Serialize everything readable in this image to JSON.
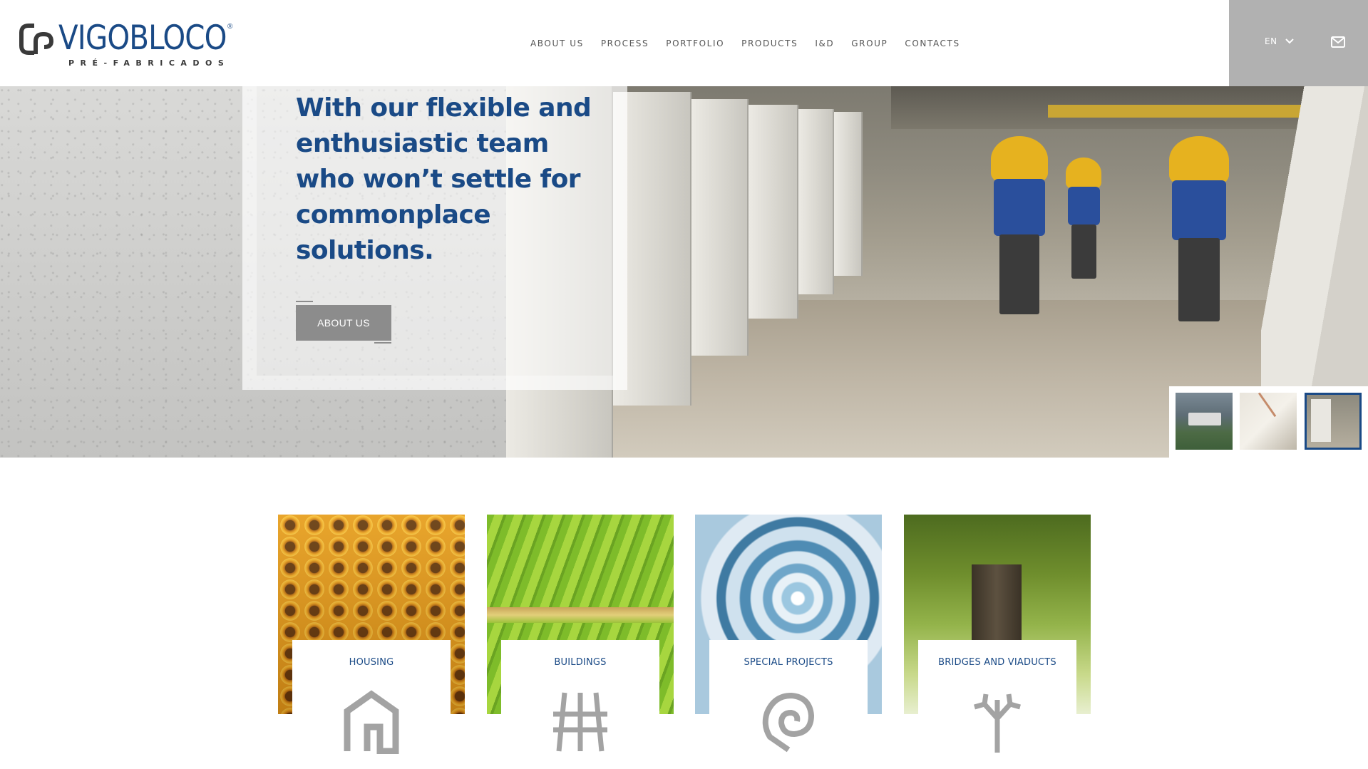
{
  "brand": {
    "name": "VIGOBLOCO",
    "registered": "®",
    "tagline": "PRÉ-FABRICADOS"
  },
  "nav": {
    "items": [
      {
        "label": "ABOUT US"
      },
      {
        "label": "PROCESS"
      },
      {
        "label": "PORTFOLIO"
      },
      {
        "label": "PRODUCTS"
      },
      {
        "label": "I&D"
      },
      {
        "label": "GROUP"
      },
      {
        "label": "CONTACTS"
      }
    ]
  },
  "utility": {
    "language": "EN",
    "language_icon": "chevron-down-icon",
    "contact_icon": "envelope-icon",
    "background": "#b1b1b1"
  },
  "hero": {
    "title": "With our flexible and enthusiastic team who won’t settle for commonplace solutions.",
    "button_label": "ABOUT US",
    "active_slide": 3,
    "slide_count": 3
  },
  "categories": [
    {
      "label": "HOUSING",
      "icon": "house-icon"
    },
    {
      "label": "BUILDINGS",
      "icon": "buildings-icon"
    },
    {
      "label": "SPECIAL PROJECTS",
      "icon": "spiral-icon"
    },
    {
      "label": "BRIDGES AND VIADUCTS",
      "icon": "tree-icon"
    }
  ],
  "colors": {
    "brand_blue": "#1a4a86",
    "button_gray": "#8c8c8c",
    "icon_gray": "#a3a3a3"
  }
}
